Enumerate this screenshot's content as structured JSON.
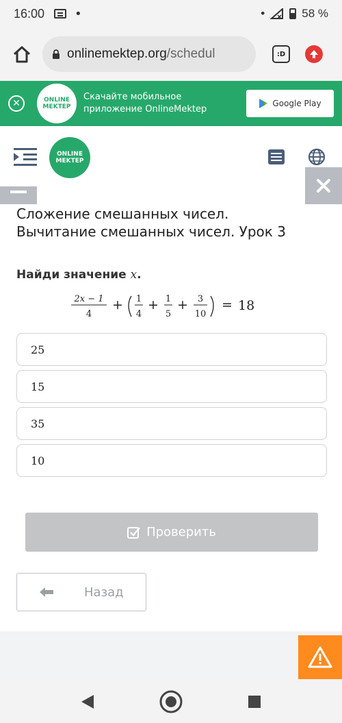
{
  "status_bar": {
    "time": "16:00",
    "dot": "•",
    "right_dot": "•",
    "battery": "58 %"
  },
  "browser": {
    "url_main": "onlinemektep.org",
    "url_path": "/schedul",
    "tab_count": ":D"
  },
  "promo": {
    "close": "⊗",
    "logo_line1": "ONLINE",
    "logo_line2": "MEKTEP",
    "text": "Скачайте мобильное приложение OnlineMektep",
    "store_label": "Google Play"
  },
  "header": {
    "logo_line1": "ONLINE",
    "logo_line2": "MEKTEP"
  },
  "lesson": {
    "title": "Сложение смешанных чисел. Вычитание смешанных чисел. Урок 3",
    "task_prefix": "Найди значение ",
    "task_var": "x",
    "task_suffix": ".",
    "equation": {
      "num1": "2x − 1",
      "den1": "4",
      "plus": "+",
      "f1_num": "1",
      "f1_den": "4",
      "f2_num": "1",
      "f2_den": "5",
      "f3_num": "3",
      "f3_den": "10",
      "equals": "=",
      "result": "18"
    },
    "options": [
      "25",
      "15",
      "35",
      "10"
    ]
  },
  "actions": {
    "check_label": "Проверить",
    "back_label": "Назад"
  },
  "colors": {
    "brand_green": "#26a86a",
    "report_orange": "#ff8a1e",
    "disabled_gray": "#c2c4c6"
  }
}
